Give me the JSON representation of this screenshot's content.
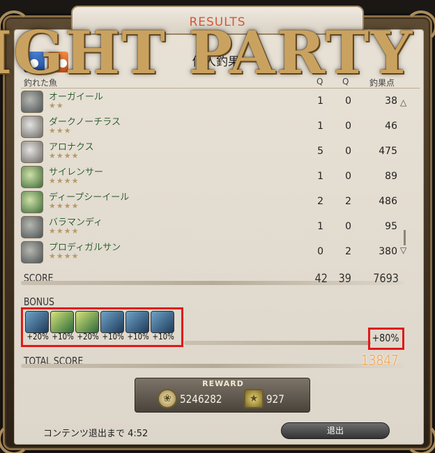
{
  "window": {
    "tab_title": "RESULTS",
    "overlay_title": "IGHT PARTY",
    "header_title": "個人釣果"
  },
  "columns": {
    "name": "釣れた魚",
    "hq": "Q",
    "nq": "Q",
    "points": "釣果点"
  },
  "fish": [
    {
      "name": "オーガイール",
      "stars": "★★",
      "a": "1",
      "b": "0",
      "pts": "38"
    },
    {
      "name": "ダークノーチラス",
      "stars": "★★★",
      "a": "1",
      "b": "0",
      "pts": "46"
    },
    {
      "name": "アロナクス",
      "stars": "★★★★",
      "a": "5",
      "b": "0",
      "pts": "475"
    },
    {
      "name": "サイレンサー",
      "stars": "★★★★",
      "a": "1",
      "b": "0",
      "pts": "89"
    },
    {
      "name": "ディープシーイール",
      "stars": "★★★★",
      "a": "2",
      "b": "2",
      "pts": "486"
    },
    {
      "name": "バラマンディ",
      "stars": "★★★★",
      "a": "1",
      "b": "0",
      "pts": "95"
    },
    {
      "name": "プロディガルサン",
      "stars": "★★★★",
      "a": "0",
      "b": "2",
      "pts": "380"
    }
  ],
  "score": {
    "label": "SCORE",
    "a": "42",
    "b": "39",
    "total": "7693"
  },
  "bonus": {
    "label": "BONUS",
    "items": [
      "+20%",
      "+10%",
      "+20%",
      "+10%",
      "+10%",
      "+10%"
    ],
    "total": "+80%"
  },
  "total_score": {
    "label": "TOTAL SCORE",
    "value": "13847"
  },
  "reward": {
    "title": "REWARD",
    "gil": "5246282",
    "seals": "927"
  },
  "footer": {
    "timer": "コンテンツ退出まで 4:52",
    "exit": "退出"
  },
  "colors": {
    "highlight_box": "#e01919",
    "total_score": "#f0b06a",
    "fish_name": "#2d5b2a"
  }
}
